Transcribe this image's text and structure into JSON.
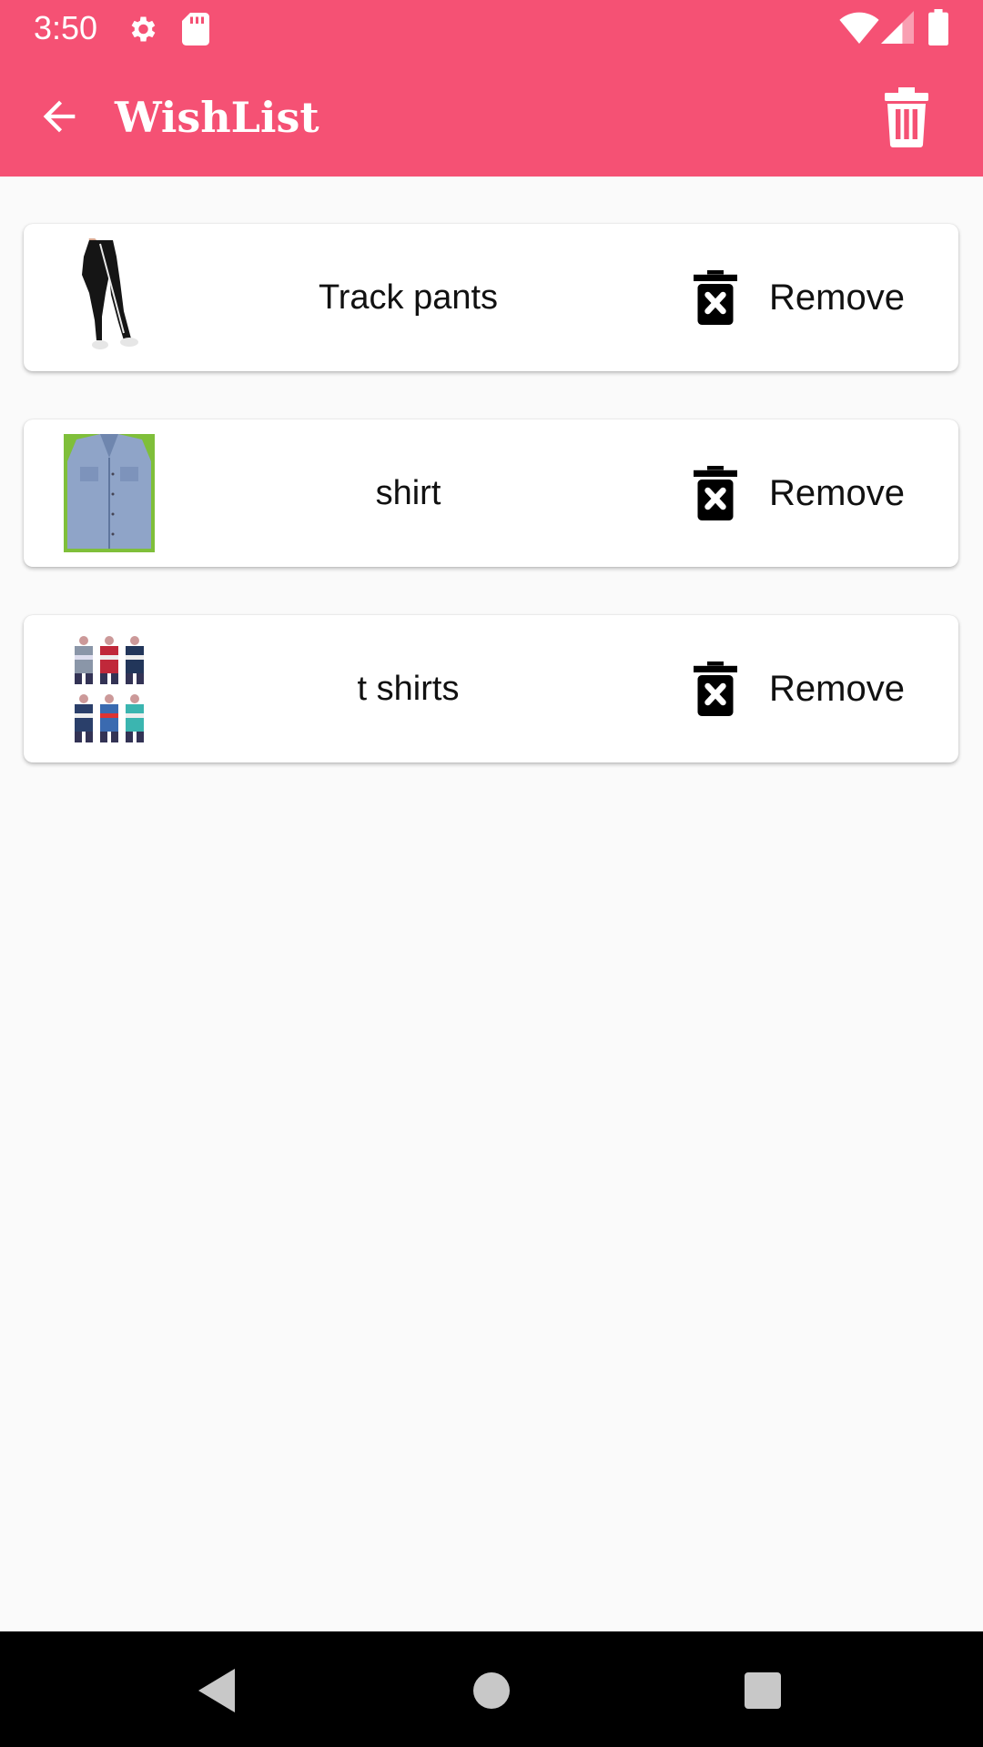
{
  "status_bar": {
    "time": "3:50",
    "icons": [
      "settings-icon",
      "sd-card-icon",
      "wifi-icon",
      "signal-icon",
      "battery-icon"
    ]
  },
  "app_bar": {
    "title": "WishList",
    "back_icon": "arrow-back-icon",
    "delete_all_icon": "trash-icon",
    "background_color": "#f55174"
  },
  "wishlist": {
    "items": [
      {
        "name": "Track pants",
        "remove_label": "Remove",
        "thumbnail": "track-pants-image"
      },
      {
        "name": "shirt",
        "remove_label": "Remove",
        "thumbnail": "denim-shirt-image"
      },
      {
        "name": "t shirts",
        "remove_label": "Remove",
        "thumbnail": "t-shirts-image"
      }
    ]
  },
  "nav_bar": {
    "icons": [
      "back-nav-icon",
      "home-nav-icon",
      "recents-nav-icon"
    ]
  }
}
